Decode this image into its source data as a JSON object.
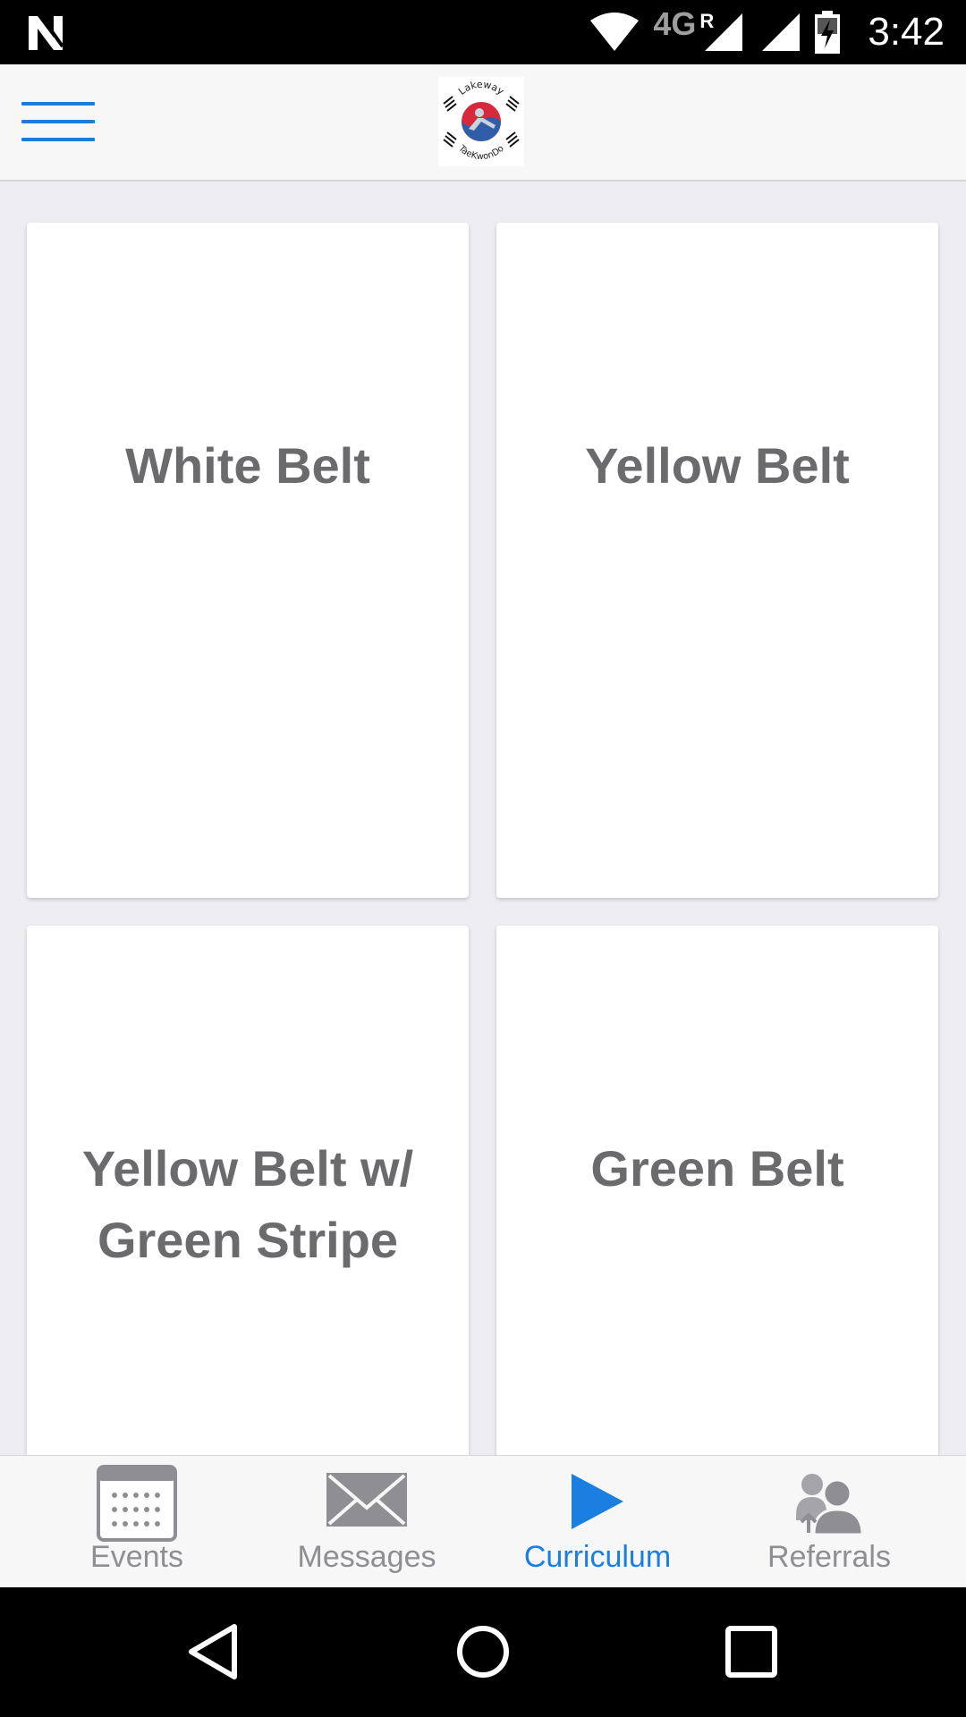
{
  "status_bar": {
    "time": "3:42",
    "network": "4G",
    "roaming": "R",
    "icons": [
      "notification-n-icon",
      "wifi-icon",
      "signal-roaming-icon",
      "signal-icon",
      "battery-charging-icon"
    ]
  },
  "header": {
    "menu_icon": "hamburger-menu-icon",
    "logo_top_text": "Lakeway",
    "logo_bottom_text": "TaeKwonDo"
  },
  "cards": [
    {
      "label": "White Belt"
    },
    {
      "label": "Yellow Belt"
    },
    {
      "label": "Yellow Belt w/ Green Stripe"
    },
    {
      "label": "Green Belt"
    }
  ],
  "tabs": [
    {
      "label": "Events",
      "icon": "calendar-icon",
      "active": false
    },
    {
      "label": "Messages",
      "icon": "envelope-icon",
      "active": false
    },
    {
      "label": "Curriculum",
      "icon": "play-icon",
      "active": true
    },
    {
      "label": "Referrals",
      "icon": "referrals-people-icon",
      "active": false
    }
  ],
  "colors": {
    "accent": "#1a7fe0",
    "tab_inactive": "#8e8e93",
    "card_text": "#6b6b6e",
    "background": "#eeeef2"
  },
  "nav": {
    "icons": [
      "back-icon",
      "home-icon",
      "recents-icon"
    ]
  }
}
